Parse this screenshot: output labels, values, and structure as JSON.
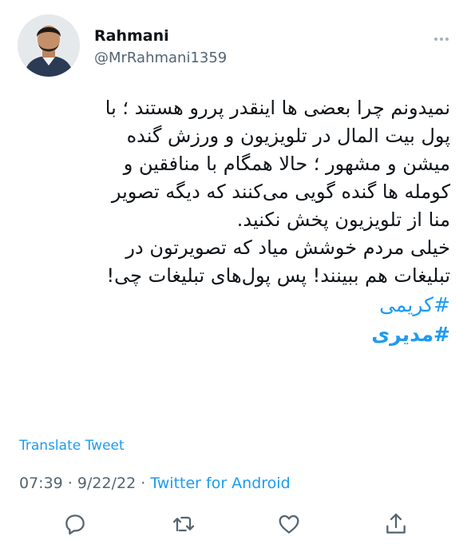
{
  "user": {
    "display_name": "Rahmani",
    "handle": "@MrRahmani1359"
  },
  "tweet": {
    "lines": [
      "نمیدونم چرا بعضی ها اینقدر پررو هستند ؛ با",
      "پول بیت المال در تلویزیون و ورزش گنده",
      "میشن و مشهور ؛ حالا همگام با منافقین و",
      "کومله ها گنده گویی می‌کنند که دیگه تصویر",
      "منا از تلویزیون پخش نکنید.",
      "خیلی مردم خوشش میاد که تصویرتون در",
      "تبلیغات هم ببینند! پس پول‌های تبلیغات چی!"
    ],
    "hashtags": [
      "#کریمی",
      "#مدیری"
    ]
  },
  "translate_label": "Translate Tweet",
  "meta": {
    "time": "07:39",
    "separator": "·",
    "date": "9/22/22",
    "source": "Twitter for Android"
  },
  "icons": {
    "more": "more-dots-icon",
    "reply": "reply-icon",
    "retweet": "retweet-icon",
    "like": "heart-icon",
    "share": "share-icon"
  },
  "colors": {
    "accent": "#1d9bf0",
    "secondary_text": "#536471",
    "icon": "#536471"
  }
}
